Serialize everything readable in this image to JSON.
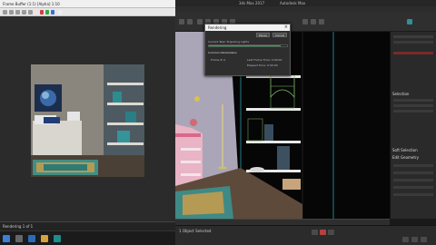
{
  "frame_buffer": {
    "title": "Frame Buffer (1:1) [Alpha] 1:10",
    "status": "Rendering 1 of 1"
  },
  "max_window": {
    "title": "3ds Max 2017",
    "file": "Autodesk Max"
  },
  "render_dialog": {
    "title": "Rendering",
    "pause_label": "Pause",
    "cancel_label": "Cancel",
    "current_task": "Current Task: Preparing Lights",
    "total_progress": 0.92,
    "section_title": "Common Parameters",
    "frame_label": "Frame #",
    "frame_value": "0",
    "last_frame_time_label": "Last Frame Time: 0:00:00",
    "elapsed_label": "Elapsed Time: 0:00:00"
  },
  "command_panel": {
    "headers": [
      "Selection",
      "Soft Selection",
      "Edit Geometry"
    ]
  },
  "status_bar": {
    "selected": "1 Object Selected"
  },
  "colors": {
    "accent": "#21b24b",
    "viewport_bg": "#060606",
    "cyan_line": "#2fb4c4",
    "max_ui": "#2b2b2b"
  }
}
